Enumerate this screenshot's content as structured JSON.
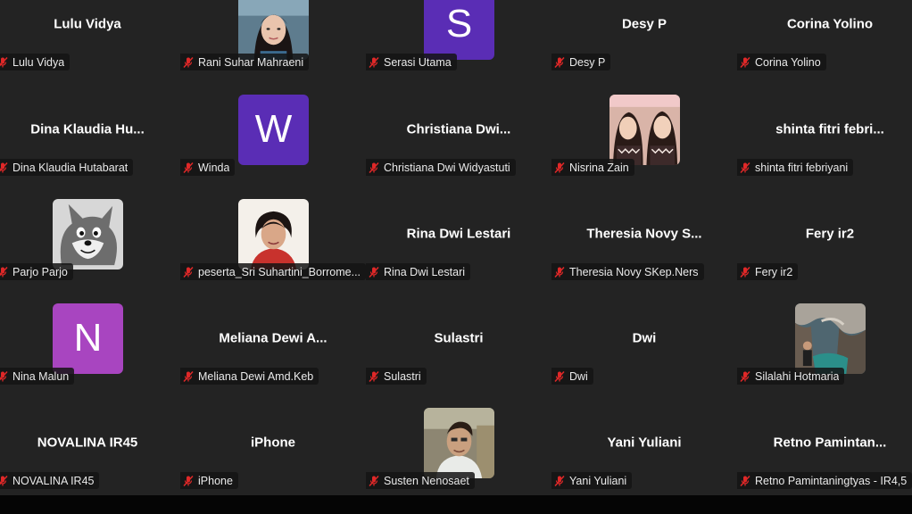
{
  "colors": {
    "tile_bg": "#232323",
    "mute_red": "#e02828",
    "avatar_purple": "#5a2db5",
    "avatar_magenta": "#a845c0"
  },
  "tiles": [
    {
      "center_name": "Lulu Vidya",
      "tag": "Lulu Vidya",
      "avatar": "none"
    },
    {
      "center_name": "",
      "tag": "Rani Suhar Mahraeni",
      "avatar": "photo-woman-portrait"
    },
    {
      "center_name": "",
      "tag": "Serasi Utama",
      "avatar": "letter",
      "letter": "S"
    },
    {
      "center_name": "Desy P",
      "tag": "Desy P",
      "avatar": "none"
    },
    {
      "center_name": "Corina Yolino",
      "tag": "Corina Yolino",
      "avatar": "none"
    },
    {
      "center_name": "Dina Klaudia Hu...",
      "tag": "Dina Klaudia Hutabarat",
      "avatar": "none"
    },
    {
      "center_name": "",
      "tag": "Winda",
      "avatar": "letter",
      "letter": "W"
    },
    {
      "center_name": "Christiana Dwi...",
      "tag": "Christiana Dwi Widyastuti",
      "avatar": "none"
    },
    {
      "center_name": "",
      "tag": "Nisrina Zain",
      "avatar": "photo-two-women"
    },
    {
      "center_name": "shinta fitri febri...",
      "tag": "shinta fitri febriyani",
      "avatar": "none"
    },
    {
      "center_name": "",
      "tag": "Parjo Parjo",
      "avatar": "photo-cartoon-fox"
    },
    {
      "center_name": "",
      "tag": "peserta_Sri Suhartini_Borrome...",
      "avatar": "photo-woman-red"
    },
    {
      "center_name": "Rina Dwi Lestari",
      "tag": "Rina Dwi Lestari",
      "avatar": "none"
    },
    {
      "center_name": "Theresia Novy S...",
      "tag": "Theresia Novy SKep.Ners",
      "avatar": "none"
    },
    {
      "center_name": "Fery ir2",
      "tag": "Fery ir2",
      "avatar": "none"
    },
    {
      "center_name": "",
      "tag": "Nina Malun",
      "avatar": "letter",
      "letter": "N"
    },
    {
      "center_name": "Meliana Dewi A...",
      "tag": "Meliana Dewi Amd.Keb",
      "avatar": "none"
    },
    {
      "center_name": "Sulastri",
      "tag": "Sulastri",
      "avatar": "none"
    },
    {
      "center_name": "Dwi",
      "tag": "Dwi",
      "avatar": "none"
    },
    {
      "center_name": "",
      "tag": "Silalahi Hotmaria",
      "avatar": "photo-rocks-sea"
    },
    {
      "center_name": "NOVALINA IR45",
      "tag": "NOVALINA IR45",
      "avatar": "none"
    },
    {
      "center_name": "iPhone",
      "tag": "iPhone",
      "avatar": "none"
    },
    {
      "center_name": "",
      "tag": "Susten Nenosaet",
      "avatar": "photo-man"
    },
    {
      "center_name": "Yani Yuliani",
      "tag": "Yani Yuliani",
      "avatar": "none"
    },
    {
      "center_name": "Retno Pamintan...",
      "tag": "Retno Pamintaningtyas - IR4,5",
      "avatar": "none"
    }
  ]
}
